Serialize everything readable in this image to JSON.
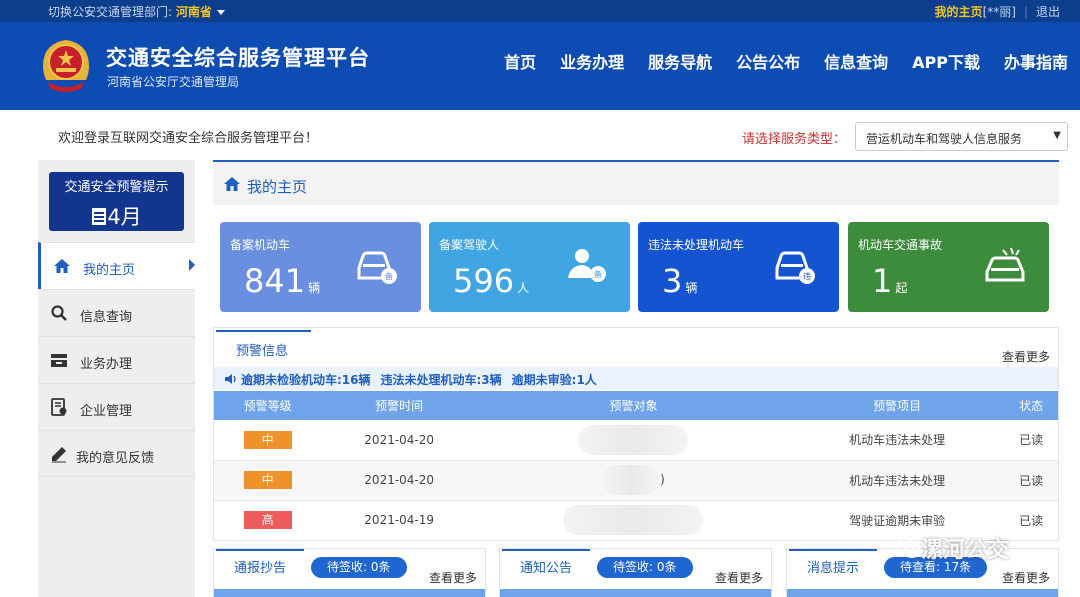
{
  "topbar": {
    "dept_label": "切换公安交通管理部门: ",
    "dept_value": "河南省",
    "my_home": "我的主页",
    "user": "[**丽]",
    "logout": "退出"
  },
  "header": {
    "title": "交通安全综合服务管理平台",
    "subtitle": "河南省公安厅交通管理局",
    "nav": [
      "首页",
      "业务办理",
      "服务导航",
      "公告公布",
      "信息查询",
      "APP下载",
      "办事指南"
    ]
  },
  "welcome": "欢迎登录互联网交通安全综合服务管理平台！",
  "service": {
    "label": "请选择服务类型：",
    "selected": "营运机动车和驾驶人信息服务"
  },
  "sidebar": {
    "warn_title": "交通安全预警提示",
    "warn_month": "4月",
    "items": [
      {
        "label": "我的主页",
        "icon": "home-icon"
      },
      {
        "label": "信息查询",
        "icon": "search-icon"
      },
      {
        "label": "业务办理",
        "icon": "inbox-icon"
      },
      {
        "label": "企业管理",
        "icon": "document-icon"
      },
      {
        "label": "我的意见反馈",
        "icon": "feedback-icon"
      }
    ]
  },
  "main": {
    "title": "我的主页",
    "stats": [
      {
        "label": "备案机动车",
        "value": "841",
        "unit": "辆",
        "color": "#6b8fe0",
        "icon": "car-badge-icon"
      },
      {
        "label": "备案驾驶人",
        "value": "596",
        "unit": "人",
        "color": "#3fa6e3",
        "icon": "person-badge-icon"
      },
      {
        "label": "违法未处理机动车",
        "value": "3",
        "unit": "辆",
        "color": "#1554d1",
        "icon": "car-violation-icon"
      },
      {
        "label": "机动车交通事故",
        "value": "1",
        "unit": "起",
        "color": "#3c8c3c",
        "icon": "car-crash-icon"
      }
    ]
  },
  "warnings": {
    "tab": "预警信息",
    "more": "查看更多",
    "ticker": [
      "逾期未检验机动车:16辆",
      "违法未处理机动车:3辆",
      "逾期未审验:1人"
    ],
    "columns": [
      "预警等级",
      "预警时间",
      "预警对象",
      "预警项目",
      "状态"
    ],
    "rows": [
      {
        "level": "中",
        "level_color": "#f0922b",
        "time": "2021-04-20",
        "target": "",
        "item": "机动车违法未处理",
        "status": "已读"
      },
      {
        "level": "中",
        "level_color": "#f0922b",
        "time": "2021-04-20",
        "target": ")",
        "item": "机动车违法未处理",
        "status": "已读"
      },
      {
        "level": "高",
        "level_color": "#ef5a5a",
        "time": "2021-04-19",
        "target": "",
        "item": "驾驶证逾期未审验",
        "status": "已读"
      }
    ]
  },
  "bottom_panels": [
    {
      "tab": "通报抄告",
      "badge": "待签收: 0条",
      "more": "查看更多"
    },
    {
      "tab": "通知公告",
      "badge": "待签收: 0条",
      "more": "查看更多"
    },
    {
      "tab": "消息提示",
      "badge": "待查看: 17条",
      "more": "查看更多"
    }
  ],
  "watermark": "漯河公交"
}
